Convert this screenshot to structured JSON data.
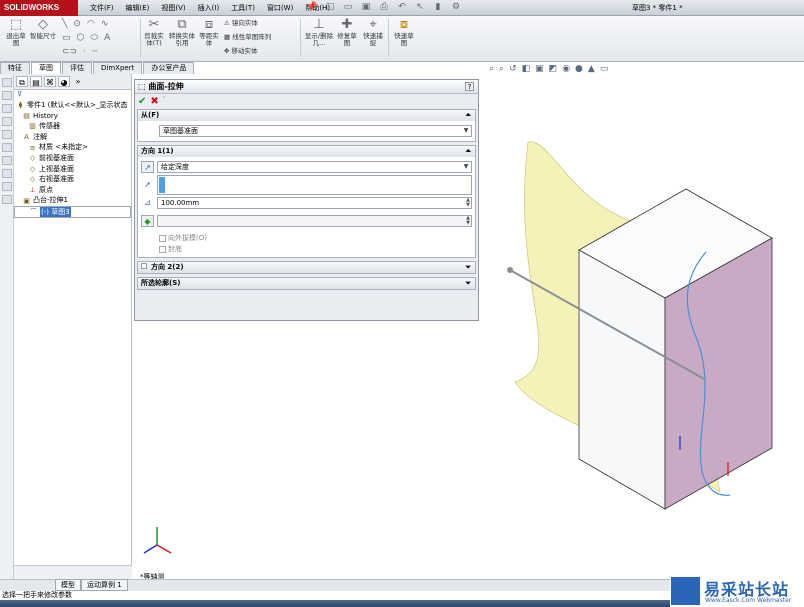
{
  "app": {
    "logo": "SOLIDWORKS",
    "doc_title": "草图3 * 零件1 *"
  },
  "menus": [
    "文件(F)",
    "编辑(E)",
    "视图(V)",
    "插入(I)",
    "工具(T)",
    "窗口(W)",
    "帮助(H)"
  ],
  "ribbon": {
    "exit_sketch": "退出草图",
    "smart_dim": "智能尺寸",
    "trim": "剪裁实体(T)",
    "convert": "转换实体引用",
    "offset": "等距实体",
    "mirror": "镜向实体",
    "linear_pattern": "线性草图阵列",
    "move": "移动实体",
    "display_delete": "显示/删除几...",
    "repair": "修复草图",
    "quick_snap": "快速捕捉",
    "rapid_sketch": "快速草图"
  },
  "cmd_tabs": [
    "特征",
    "草图",
    "评估",
    "DimXpert",
    "办公室产品"
  ],
  "tree": {
    "filter_icon": "filter-icon",
    "items": [
      {
        "label": "零件1 (默认<<默认>_显示状态",
        "icon": "part"
      },
      {
        "label": "History",
        "icon": "folder"
      },
      {
        "label": "传感器",
        "icon": "sensor"
      },
      {
        "label": "注解",
        "icon": "annotation"
      },
      {
        "label": "材质 <未指定>",
        "icon": "material"
      },
      {
        "label": "前视基准面",
        "icon": "plane"
      },
      {
        "label": "上视基准面",
        "icon": "plane"
      },
      {
        "label": "右视基准面",
        "icon": "plane"
      },
      {
        "label": "原点",
        "icon": "origin"
      },
      {
        "label": "凸台-拉伸1",
        "icon": "extrude"
      },
      {
        "label": "(-) 草图3",
        "icon": "sketch"
      }
    ]
  },
  "property_manager": {
    "title": "曲面-拉伸",
    "help": "?",
    "from": {
      "header": "从(F)",
      "value": "草图基准面"
    },
    "direction1": {
      "header": "方向 1(1)",
      "end_condition": "给定深度",
      "depth": "100.00mm",
      "draft_outward": "向外拔模(O)",
      "capped": "封底"
    },
    "direction2": {
      "header": "方向 2(2)"
    },
    "selected_contours": {
      "header": "所选轮廓(S)"
    }
  },
  "viewport": {
    "view_label": "*等轴测"
  },
  "bottom_tabs": [
    "模型",
    "运动算例 1"
  ],
  "status": "选择一把手来修改参数",
  "watermark": {
    "title": "易采站长站",
    "subtitle": "Www.Easck.Com  Webmaster"
  }
}
